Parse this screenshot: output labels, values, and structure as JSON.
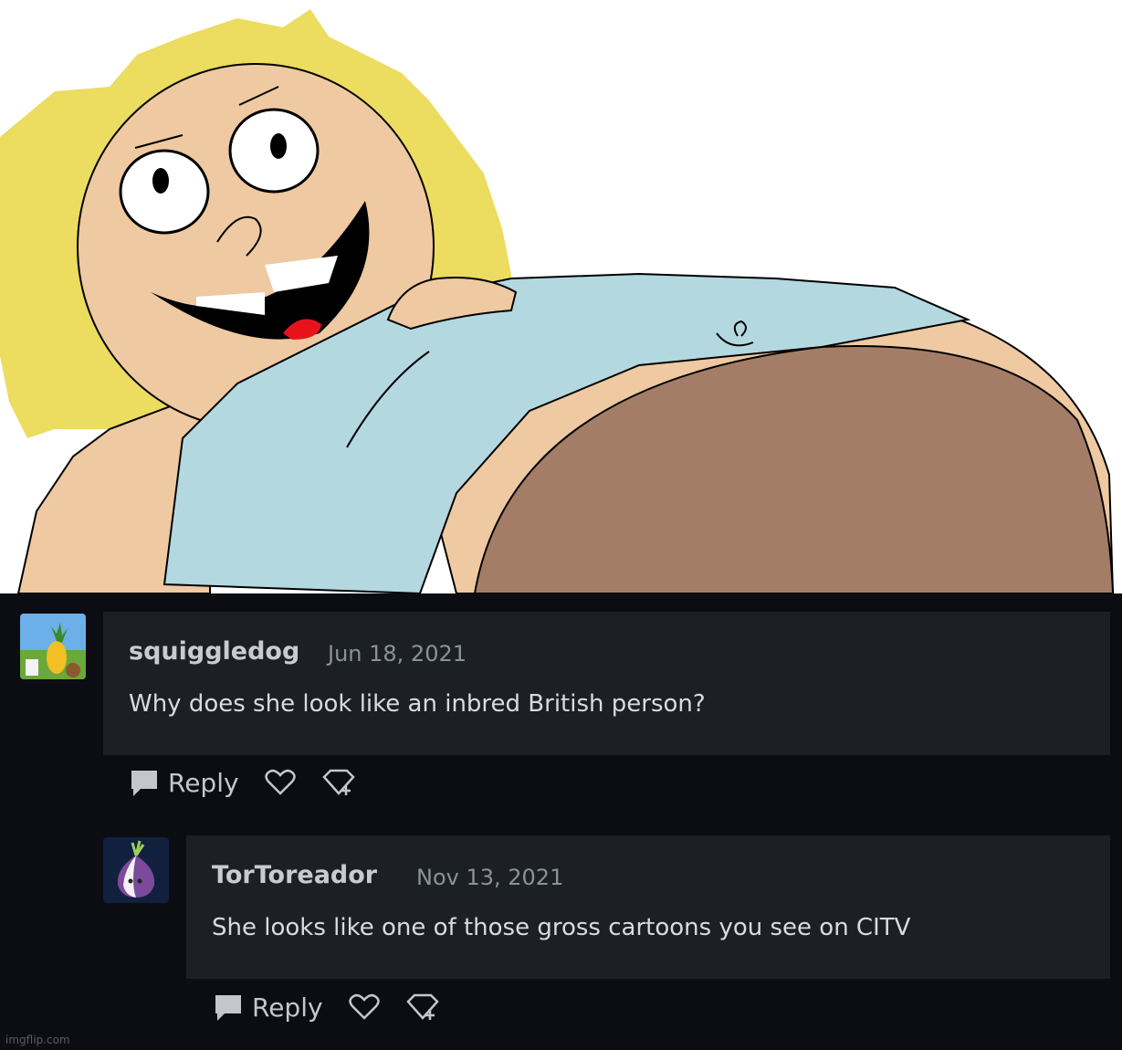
{
  "comments": [
    {
      "username": "squiggledog",
      "date": "Jun 18, 2021",
      "text": "Why does she look like an inbred British person?",
      "reply_label": "Reply",
      "avatar_icon": "pineapple-avatar-icon"
    },
    {
      "username": "TorToreador",
      "date": "Nov 13, 2021",
      "text": "She looks like one of those gross cartoons you see on CITV",
      "reply_label": "Reply",
      "avatar_icon": "onion-avatar-icon"
    }
  ],
  "watermark": "imgflip.com",
  "colors": {
    "hair": "#ecdc5f",
    "skin": "#eec9a1",
    "shirt": "#b3d8e0",
    "belly_shadow": "#a47d66",
    "tongue": "#e8131a",
    "card_bg": "#1c1f25",
    "page_bg": "#0b0d12"
  }
}
